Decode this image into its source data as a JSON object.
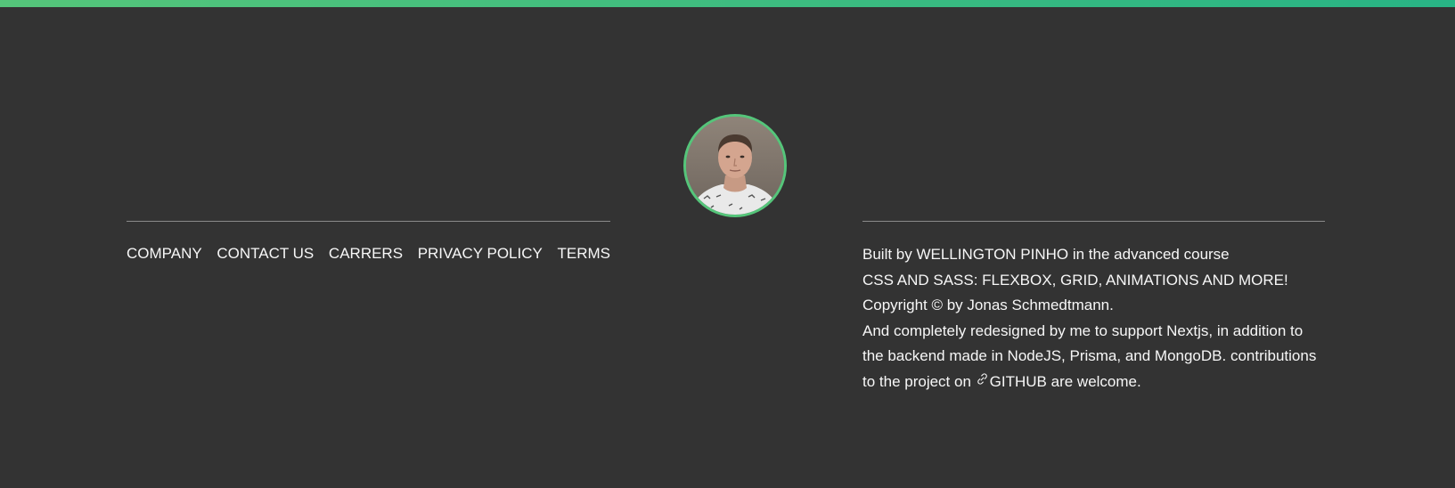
{
  "accent": {
    "green_light": "#55c57a",
    "green_dark": "#28b485",
    "background": "#333333"
  },
  "profile": {
    "avatar_alt": "Wellington Pinho photo",
    "icon": "avatar-photo"
  },
  "footer_nav": {
    "items": [
      {
        "label": "COMPANY"
      },
      {
        "label": "CONTACT US"
      },
      {
        "label": "CARRERS"
      },
      {
        "label": "PRIVACY POLICY"
      },
      {
        "label": "TERMS"
      }
    ]
  },
  "copyright": {
    "line1": "Built by WELLINGTON PINHO in the advanced course",
    "line2": "CSS AND SASS: FLEXBOX, GRID, ANIMATIONS AND MORE!",
    "line3": "Copyright © by Jonas Schmedtmann.",
    "line4": "And completely redesigned by me to support Nextjs, in addition to the backend made in NodeJS, Prisma, and MongoDB. contributions to the project on",
    "link_label": "GITHUB",
    "link_icon": "link-icon",
    "line_end": "are welcome."
  }
}
